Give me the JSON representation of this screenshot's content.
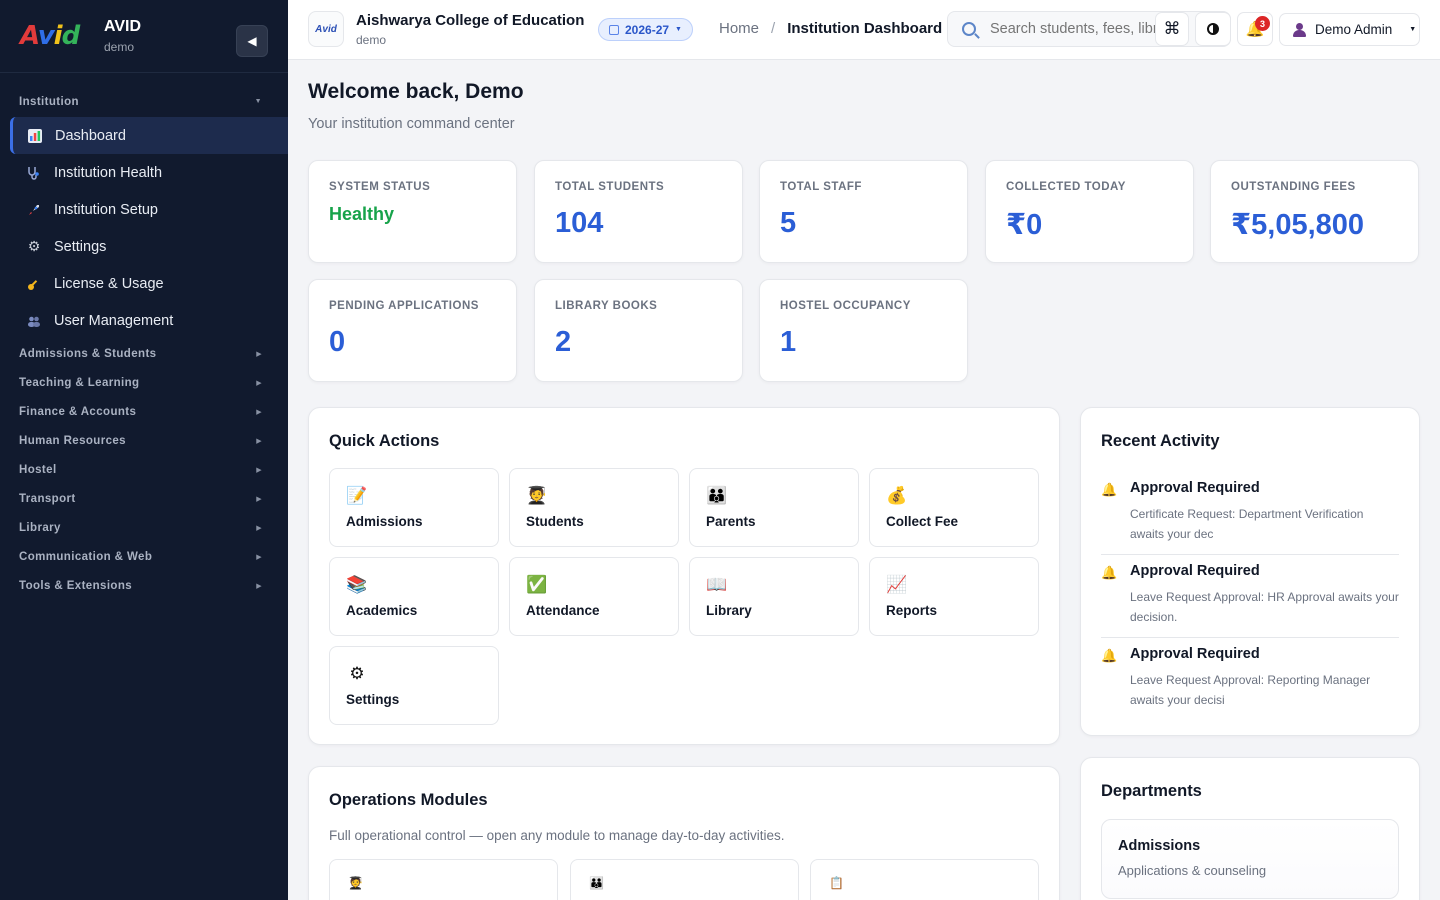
{
  "brand": {
    "name": "AVID",
    "sub": "demo",
    "logo_text": "Avid"
  },
  "sidebar": {
    "groups": [
      {
        "label": "Institution",
        "open": true,
        "items": [
          {
            "label": "Dashboard",
            "icon": "bar-chart-icon",
            "active": true
          },
          {
            "label": "Institution Health",
            "icon": "stethoscope-icon"
          },
          {
            "label": "Institution Setup",
            "icon": "rocket-icon"
          },
          {
            "label": "Settings",
            "icon": "gear-icon"
          },
          {
            "label": "License & Usage",
            "icon": "key-icon"
          },
          {
            "label": "User Management",
            "icon": "users-icon"
          }
        ]
      },
      {
        "label": "Admissions & Students"
      },
      {
        "label": "Teaching & Learning"
      },
      {
        "label": "Finance & Accounts"
      },
      {
        "label": "Human Resources"
      },
      {
        "label": "Hostel"
      },
      {
        "label": "Transport"
      },
      {
        "label": "Library"
      },
      {
        "label": "Communication & Web"
      },
      {
        "label": "Tools & Extensions"
      }
    ]
  },
  "topbar": {
    "institution_name": "Aishwarya College of Education",
    "institution_sub": "demo",
    "logo_text": "Avid",
    "academic_year": "2026-27",
    "breadcrumb": {
      "home": "Home",
      "separator": "/",
      "current": "Institution Dashboard"
    },
    "search_placeholder": "Search students, fees, library...",
    "kbd_symbol": "⌘",
    "notification_count": "3",
    "user_name": "Demo Admin"
  },
  "welcome": {
    "title": "Welcome back, Demo",
    "subtitle": "Your institution command center"
  },
  "stats": [
    {
      "label": "SYSTEM STATUS",
      "value": "Healthy",
      "status": true
    },
    {
      "label": "TOTAL STUDENTS",
      "value": "104"
    },
    {
      "label": "TOTAL STAFF",
      "value": "5"
    },
    {
      "label": "COLLECTED TODAY",
      "value": "₹0"
    },
    {
      "label": "OUTSTANDING FEES",
      "value": "₹5,05,800"
    },
    {
      "label": "PENDING APPLICATIONS",
      "value": "0"
    },
    {
      "label": "LIBRARY BOOKS",
      "value": "2"
    },
    {
      "label": "HOSTEL OCCUPANCY",
      "value": "1"
    }
  ],
  "quick_actions": {
    "title": "Quick Actions",
    "items": [
      {
        "label": "Admissions",
        "emoji": "📝",
        "icon": "memo-icon"
      },
      {
        "label": "Students",
        "emoji": "🧑‍🎓",
        "icon": "student-icon"
      },
      {
        "label": "Parents",
        "emoji": "👪",
        "icon": "family-icon"
      },
      {
        "label": "Collect Fee",
        "emoji": "💰",
        "icon": "money-bag-icon"
      },
      {
        "label": "Academics",
        "emoji": "📚",
        "icon": "books-icon"
      },
      {
        "label": "Attendance",
        "emoji": "✅",
        "icon": "check-mark-icon"
      },
      {
        "label": "Library",
        "emoji": "📖",
        "icon": "open-book-icon"
      },
      {
        "label": "Reports",
        "emoji": "📈",
        "icon": "chart-up-icon"
      },
      {
        "label": "Settings",
        "emoji": "⚙",
        "icon": "gear-icon"
      }
    ]
  },
  "recent_activity": {
    "title": "Recent Activity",
    "items": [
      {
        "title": "Approval Required",
        "desc": "Certificate Request: Department Verification awaits your dec"
      },
      {
        "title": "Approval Required",
        "desc": "Leave Request Approval: HR Approval awaits your decision."
      },
      {
        "title": "Approval Required",
        "desc": "Leave Request Approval: Reporting Manager awaits your decisi"
      }
    ]
  },
  "departments": {
    "title": "Departments",
    "items": [
      {
        "name": "Admissions",
        "desc": "Applications & counseling"
      }
    ]
  },
  "operations": {
    "title": "Operations Modules",
    "subtitle": "Full operational control — open any module to manage day-to-day activities.",
    "tiles": [
      {
        "emoji": "🧑‍🎓",
        "icon": "student-icon"
      },
      {
        "emoji": "👪",
        "icon": "family-icon"
      },
      {
        "emoji": "📋",
        "icon": "clipboard-icon"
      }
    ]
  }
}
